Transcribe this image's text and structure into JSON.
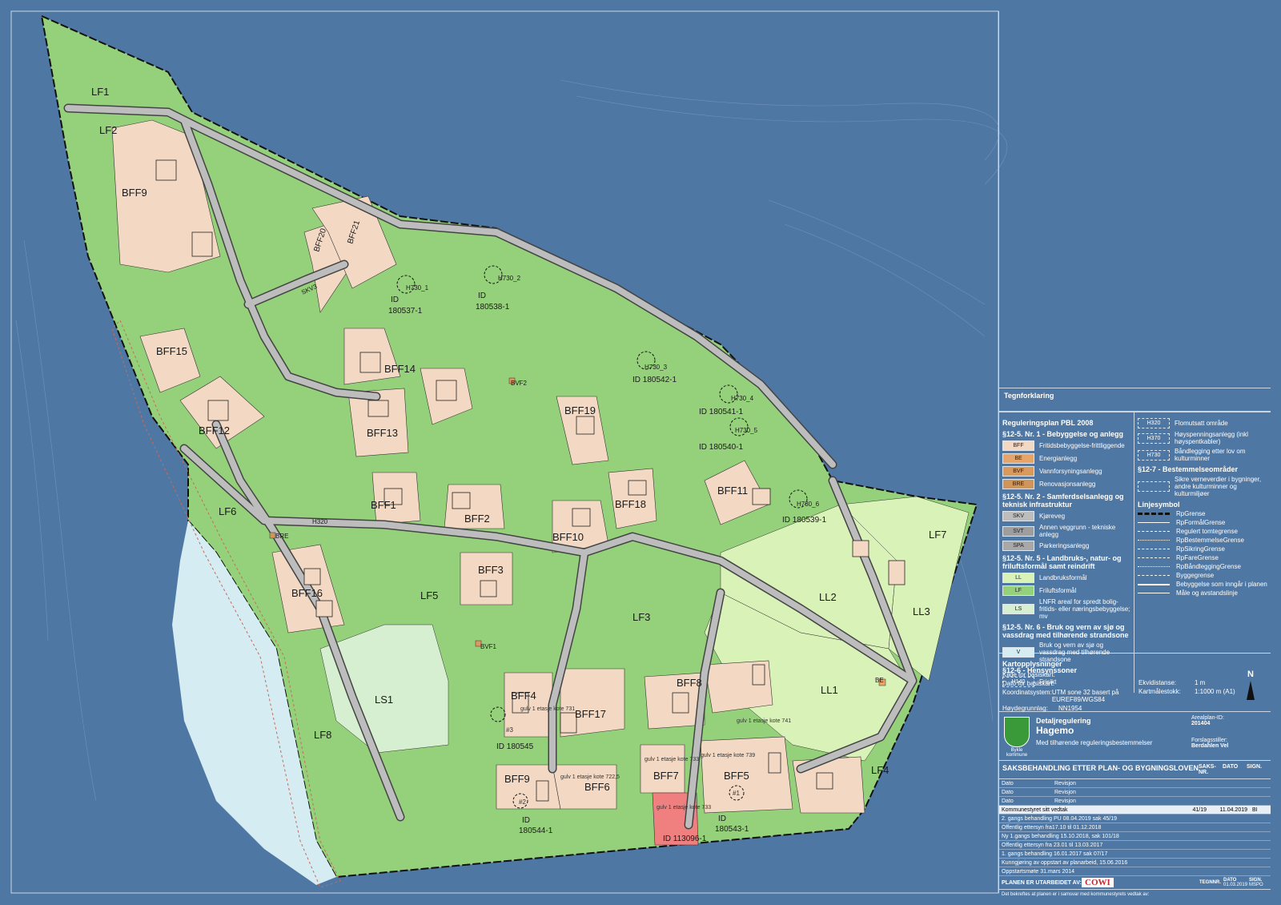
{
  "map": {
    "zones": [
      {
        "id": "LF1",
        "label": "LF1"
      },
      {
        "id": "LF2",
        "label": "LF2"
      },
      {
        "id": "BFF9a",
        "label": "BFF9"
      },
      {
        "id": "BFF20",
        "label": "BFF20"
      },
      {
        "id": "BFF21",
        "label": "BFF21"
      },
      {
        "id": "BFF15",
        "label": "BFF15"
      },
      {
        "id": "BFF14",
        "label": "BFF14"
      },
      {
        "id": "BFF12",
        "label": "BFF12"
      },
      {
        "id": "BFF13",
        "label": "BFF13"
      },
      {
        "id": "BFF19",
        "label": "BFF19"
      },
      {
        "id": "BFF1",
        "label": "BFF1"
      },
      {
        "id": "BFF2",
        "label": "BFF2"
      },
      {
        "id": "BFF10",
        "label": "BFF10"
      },
      {
        "id": "BFF18",
        "label": "BFF18"
      },
      {
        "id": "BFF11",
        "label": "BFF11"
      },
      {
        "id": "LF6",
        "label": "LF6"
      },
      {
        "id": "BFF3",
        "label": "BFF3"
      },
      {
        "id": "LF7",
        "label": "LF7"
      },
      {
        "id": "LL2",
        "label": "LL2"
      },
      {
        "id": "LL3",
        "label": "LL3"
      },
      {
        "id": "BFF16",
        "label": "BFF16"
      },
      {
        "id": "LF5",
        "label": "LF5"
      },
      {
        "id": "LF3",
        "label": "LF3"
      },
      {
        "id": "LS1",
        "label": "LS1"
      },
      {
        "id": "BFF4",
        "label": "BFF4"
      },
      {
        "id": "BFF17",
        "label": "BFF17"
      },
      {
        "id": "BFF8",
        "label": "BFF8"
      },
      {
        "id": "LL1",
        "label": "LL1"
      },
      {
        "id": "LF8",
        "label": "LF8"
      },
      {
        "id": "BFF9b",
        "label": "BFF9"
      },
      {
        "id": "BFF6",
        "label": "BFF6"
      },
      {
        "id": "BFF7",
        "label": "BFF7"
      },
      {
        "id": "BFF5",
        "label": "BFF5"
      },
      {
        "id": "LF4",
        "label": "LF4"
      }
    ],
    "small_labels": {
      "bvf2": "BVF2",
      "bvf1": "BVF1",
      "bre": "BRE",
      "be": "BE",
      "h730_1": "H730_1",
      "h730_2": "H730_2",
      "h730_3": "H730_3",
      "h730_4": "H730_4",
      "h730_5": "H730_5",
      "h730_6": "H730_6",
      "id1": "ID",
      "id1b": "180537-1",
      "id2": "ID",
      "id2b": "180538-1",
      "id3": "ID 180542-1",
      "id4": "ID 180541-1",
      "id5": "ID 180540-1",
      "id6": "ID 180539-1",
      "id7": "ID 180545",
      "id8": "ID",
      "id8b": "180544-1",
      "id9": "ID",
      "id9b": "180543-1",
      "id10": "ID 113096-1",
      "h320": "H320",
      "skv": "SKV3",
      "gulv1": "gulv 1 etasje kote 731",
      "gulv2": "gulv 1 etasje kote 733",
      "gulv3": "gulv 1 etasje kote 741",
      "gulv4": "gulv 1 etasje kote 739",
      "gulv5": "gulv 1 etasje kote 722,5",
      "gulv6": "gulv 1 etasje kote 733",
      "p2": "#2",
      "p3": "#3",
      "p1": "#1"
    }
  },
  "legend": {
    "title": "Tegnforklaring",
    "plan": "Reguleringsplan PBL 2008",
    "s1": "§12-5. Nr. 1 - Bebyggelse og anlegg",
    "bff": "BFF",
    "bff_t": "Fritidsbebyggelse-frittliggende",
    "bff_c": "#f3d9c4",
    "be": "BE",
    "be_t": "Energianlegg",
    "be_c": "#e8a56a",
    "bvf": "BVF",
    "bvf_t": "Vannforsyningsanlegg",
    "bvf_c": "#d99a5c",
    "bre": "BRE",
    "bre_t": "Renovasjonsanlegg",
    "bre_c": "#d0955a",
    "s2": "§12-5. Nr. 2 - Samferdselsanlegg og teknisk infrastruktur",
    "skv": "SKV",
    "skv_t": "Kjøreveg",
    "skv_c": "#bdbdbd",
    "svt": "SVT",
    "svt_t": "Annen veggrunn - tekniske anlegg",
    "svt_c": "#9e9e9e",
    "spa": "SPA",
    "spa_t": "Parkeringsanlegg",
    "spa_c": "#a8a8a8",
    "s5": "§12-5. Nr. 5 - Landbruks-, natur- og friluftsformål samt reindrift",
    "ll": "LL",
    "ll_t": "Landbruksformål",
    "ll_c": "#d9f2b8",
    "lf": "LF",
    "lf_t": "Friluftsformål",
    "lf_c": "#95d17a",
    "ls": "LS",
    "ls_t": "LNFR areal for spredt bolig- fritids- eller næringsbebyggelse; mv",
    "ls_c": "#d6efd0",
    "s6": "§12-5. Nr. 6 - Bruk og vern av sjø og vassdrag med tilhørende strandsone",
    "v": "V",
    "v_t": "Bruk og vern av sjø og vassdrag med tilhørende strandsone",
    "v_c": "#d4ecf2",
    "s7": "§12-6 - Hensynssoner",
    "h140": "H140",
    "h140_t": "Frisikt",
    "h320": "H320",
    "h320_t": "Flomutsatt område",
    "h370": "H370",
    "h370_t": "Høyspenningsanlegg (inkl høyspentkabler)",
    "h730": "H730",
    "h730_t": "Båndlegging etter lov om kulturminner",
    "s8": "§12-7 - Bestemmelseområder",
    "s8_t": "Sikre verneverdier i bygninger, andre kulturminner og kulturmiljøer",
    "linjesymbol": "Linjesymbol",
    "lines": [
      "RpGrense",
      "RpFormålGrense",
      "Regulert tomtegrense",
      "RpBestemmelseGrense",
      "RpSikringGrense",
      "RpFareGrense",
      "RpBåndleggingGrense",
      "Byggegrense",
      "Bebyggelse som inngår i planen",
      "Måle og avstandslinje"
    ]
  },
  "kart": {
    "heading": "Kartopplysninger",
    "kilde_k": "Kilde for basiskart:",
    "dato_k": "Dato for basiskart:",
    "koord_k": "Koordinatsystem:",
    "koord_v": "UTM sone 32 basert på EUREF89/WGS84",
    "hoyde_k": "Høydegrunnlag:",
    "hoyde_v": "NN1954",
    "ekvi_k": "Ekvidistanse:",
    "ekvi_v": "1 m",
    "malestokk_k": "Kartmålestokk:",
    "malestokk_v": "1:1000 m (A1)",
    "north": "N"
  },
  "title": {
    "kommune": "Bykle kommune",
    "type": "Detaljregulering",
    "name": "Hagemo",
    "sub": "Med tilhørende reguleringsbestemmelser",
    "arealplan_k": "Arealplan-ID:",
    "arealplan_v": "201404",
    "forslag_k": "Forslagsstiller:",
    "forslag_v": "Berdahlen Vel"
  },
  "saks": {
    "heading": "SAKSBEHANDLING ETTER PLAN- OG BYGNINGSLOVEN",
    "col1": "SAKS-NR.",
    "col2": "DATO",
    "col3": "SIGN.",
    "rows": [
      {
        "a": "Dato",
        "b": "Revisjon",
        "c": "",
        "d": "",
        "e": ""
      },
      {
        "a": "Dato",
        "b": "Revisjon",
        "c": "",
        "d": "",
        "e": ""
      },
      {
        "a": "Dato",
        "b": "Revisjon",
        "c": "",
        "d": "",
        "e": ""
      },
      {
        "a": "Kommunestyret sitt vedtak",
        "b": "",
        "c": "41/19",
        "d": "11.04.2019",
        "e": "BI"
      },
      {
        "a": "2. gangs behandling PU 08.04.2019 sak 45/19",
        "b": "",
        "c": "",
        "d": "",
        "e": ""
      },
      {
        "a": "Offentlig ettersyn fra17.10 til 01.12.2018",
        "b": "",
        "c": "",
        "d": "",
        "e": ""
      },
      {
        "a": "Ny 1.gangs behandling 15.10.2018, sak 101/18",
        "b": "",
        "c": "",
        "d": "",
        "e": ""
      },
      {
        "a": "Offentlig ettersyn fra 23.01 til 13.03.2017",
        "b": "",
        "c": "",
        "d": "",
        "e": ""
      },
      {
        "a": "1. gangs behandling 16.01.2017 sak 07/17",
        "b": "",
        "c": "",
        "d": "",
        "e": ""
      },
      {
        "a": "Kunngjøring av oppstart av planarbeid, 15.06.2016",
        "b": "",
        "c": "",
        "d": "",
        "e": ""
      },
      {
        "a": "Oppstartsmøte 31.mars 2014",
        "b": "",
        "c": "",
        "d": "",
        "e": ""
      }
    ],
    "utarbeidet": "PLANEN ER UTARBEIDET AV:",
    "firm": "COWI",
    "tegnnr": "TEGNNR.",
    "dato": "DATO",
    "sign": "SIGN.",
    "dato_v": "01.03.2019",
    "sign_v": "MSPO",
    "footer": "Det bekreftes at planen er i samsvar med kommunestyrets vedtak av:"
  }
}
